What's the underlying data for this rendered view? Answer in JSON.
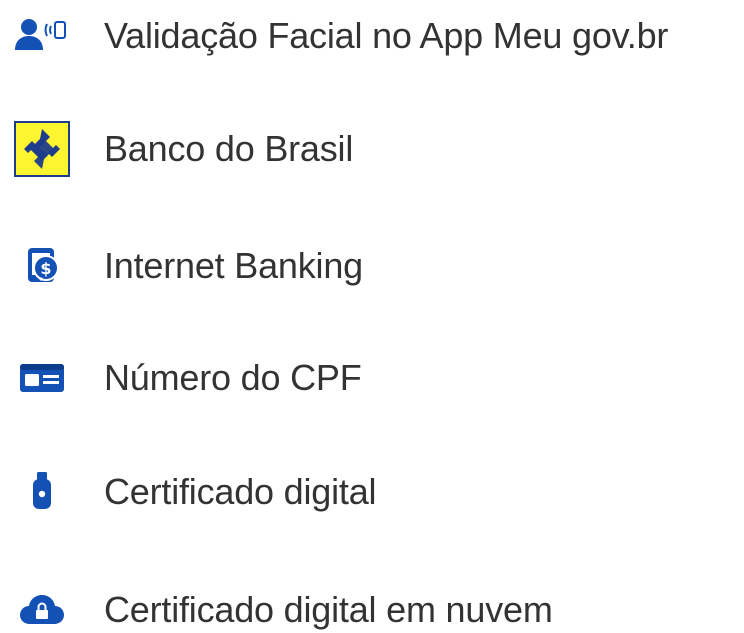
{
  "colors": {
    "icon_blue": "#1351B4",
    "bb_yellow": "#FCF52F",
    "bb_blue": "#1E3C8C",
    "text": "#333333"
  },
  "login_options": [
    {
      "label": "Validação Facial no App Meu gov.br",
      "icon": "user-face-scan-icon"
    },
    {
      "label": "Banco do Brasil",
      "icon": "banco-do-brasil-logo-icon"
    },
    {
      "label": "Internet Banking",
      "icon": "bank-dollar-icon"
    },
    {
      "label": "Número do CPF",
      "icon": "id-card-icon"
    },
    {
      "label": "Certificado digital",
      "icon": "usb-token-icon"
    },
    {
      "label": "Certificado digital em nuvem",
      "icon": "cloud-lock-icon"
    }
  ]
}
